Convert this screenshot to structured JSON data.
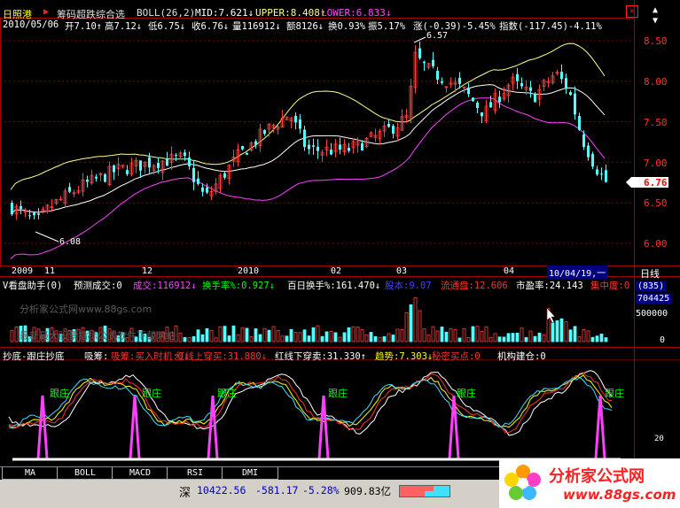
{
  "header": {
    "name": "日照港",
    "formula": "筹码超跌综合选",
    "boll_label": "BOLL(26,2)",
    "mid": "MID:7.621↓",
    "upper": "UPPER:8.408↑",
    "lower": "LOWER:6.833↓",
    "date": "2010/05/06",
    "open": "开7.10↑",
    "high": "高7.12↓",
    "low": "低6.75↓",
    "close": "收6.76↓",
    "volume": "量116912↓",
    "amount": "额8126↓",
    "turnover": "换0.93%",
    "amplitude": "振5.17%",
    "change": "涨(-0.39)-5.45%",
    "index": "指数(-117.45)-4.11%"
  },
  "price_axis": [
    "8.50",
    "8.00",
    "7.50",
    "7.00",
    "6.50",
    "6.00"
  ],
  "current_price_tag": "6.76",
  "high_marker": "6.57",
  "low_marker": "6.08",
  "time_axis": [
    "2009",
    "11",
    "12",
    "2010",
    "02",
    "03",
    "04"
  ],
  "cursor_date": "10/04/19,一",
  "period_label": "日线",
  "volume_panel": {
    "title": "V看盘助手(0)",
    "predict": "预测成交:0",
    "deal": "成交:116912↓",
    "turnover_rate": "换手率%:0.927↓",
    "hundred_day": "百日换手%:161.470↓",
    "equity": "股本:9.07",
    "float": "流通盘:12.606",
    "pe": "市盈率:24.143",
    "concentration": "集中度:0",
    "axis_top": "(835)",
    "axis_mid": "704425",
    "axis_ticks": [
      "500000",
      "0"
    ],
    "watermark1": "分析家公式网www.88gs.com",
    "watermark2": "最新最大股票指标公式软件下载网站"
  },
  "indicator_panel": {
    "title": "抄底-跟庄抄底",
    "absorb": "吸筹:买入时机:0↓",
    "red_up": "红线上穿买:31.880↓",
    "red_down": "红线下穿卖:31.330↑",
    "trend": "趋势:7.303↓",
    "secret": "秘密买点:0",
    "inst": "机构建仓:0",
    "follow_labels": [
      "跟庄",
      "跟庄",
      "跟庄",
      "跟庄",
      "跟庄",
      "跟庄"
    ],
    "axis_label": "20"
  },
  "tabs": [
    "MA",
    "BOLL",
    "MACD",
    "RSI",
    "DMI"
  ],
  "status": {
    "market": "深",
    "index_value": "10422.56",
    "index_change": "-581.17",
    "index_pct": "-5.28%",
    "amount": "909.83亿"
  },
  "brand": {
    "name": "分析家公式网",
    "url": "www.88gs.com"
  },
  "colors": {
    "up": "#ff4040",
    "down": "#54ffff",
    "upper_band": "#ffff80",
    "lower_band": "#ff40ff",
    "grid": "#800000"
  }
}
